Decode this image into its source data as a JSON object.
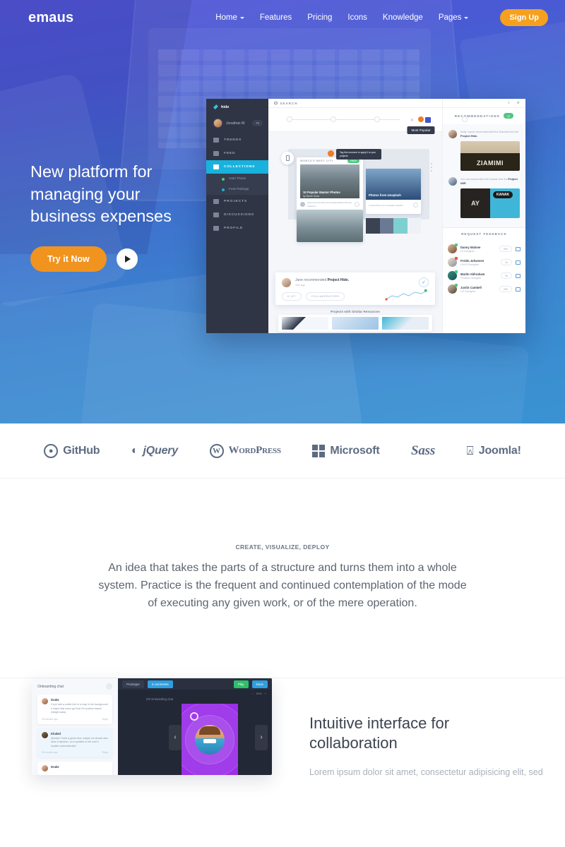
{
  "brand": {
    "logo": "emaus"
  },
  "nav": {
    "items": [
      {
        "label": "Home",
        "caret": true
      },
      {
        "label": "Features",
        "caret": false
      },
      {
        "label": "Pricing",
        "caret": false
      },
      {
        "label": "Icons",
        "caret": false
      },
      {
        "label": "Knowledge",
        "caret": false
      },
      {
        "label": "Pages",
        "caret": true
      }
    ],
    "signup_label": "Sign Up"
  },
  "hero": {
    "title_line1": "New platform for",
    "title_line2": "managing your",
    "title_line3": "business expenses",
    "cta_label": "Try it Now",
    "play_icon": "play-icon",
    "gradient_top": "#5356d6",
    "gradient_bottom": "#3a93d2",
    "accent_orange": "#f0941f"
  },
  "app": {
    "sidebar": {
      "hide_label": "hide",
      "user_name": "Jonathan M.",
      "user_badge": "75",
      "items": [
        {
          "label": "TRENDS",
          "icon": "chart-icon",
          "active": false
        },
        {
          "label": "FEED",
          "icon": "feed-icon",
          "active": false
        },
        {
          "label": "COLLECTIONS",
          "icon": "grid-icon",
          "active": true
        }
      ],
      "sub_items": [
        {
          "label": "User Flows",
          "dot": "#4ec77f"
        },
        {
          "label": "Font Pairings",
          "dot": "#18b2dd"
        }
      ],
      "items_bottom": [
        {
          "label": "PROJECTS",
          "icon": "briefcase-icon"
        },
        {
          "label": "DISCUSSIONS",
          "icon": "chat-icon"
        },
        {
          "label": "PROFILE",
          "icon": "user-icon"
        }
      ]
    },
    "main": {
      "search_label": "SEARCH",
      "tooltip": "Most Popular",
      "close_icon": "close-icon",
      "card_a": {
        "brand": "WORLD'S BEST CITY",
        "badge": "FREE",
        "caption": "10 Popular Master Photos",
        "subcaption": "by Steven Snow",
        "footer": "Jane recommended the Popular Master Photos collection",
        "footer_time": "2 hrs ago"
      },
      "card_b": {
        "caption": "Photos from Unsplash",
        "footer": "in New Photos from Unsplash collection"
      },
      "tip_a": "Tag this resource to apply it to your projects",
      "tip_b": "Tag this resource",
      "recommend": {
        "text_prefix": "Jane recommended ",
        "text_bold": "Project Hide.",
        "time": "40m ago",
        "pill1": "6,127",
        "pill2": "COLLABORATORS",
        "check_icon": "check-icon"
      },
      "similar_label": "Projects with Similar Resources"
    },
    "right": {
      "header_label": "RECOMMENDATIONS",
      "header_count": "12",
      "recs": [
        {
          "prefix": "Kelly Jones recommended the Ziamimi font for ",
          "bold": "Project Hide.",
          "poster": "ZIAMIMI"
        },
        {
          "prefix": "You recommended the Kanak font for ",
          "bold": "Project WIP.",
          "poster_l": "AY",
          "poster_r": "KANAK"
        }
      ],
      "feedback_label": "REQUEST FEEDBACK",
      "people": [
        {
          "name": "Danny Malone",
          "role": "UI Designer",
          "count": "500"
        },
        {
          "name": "Freida Johansen",
          "role": "UI/UX Designer",
          "count": "1k"
        },
        {
          "name": "Martin Abhraham",
          "role": "Product Designer",
          "count": "2k"
        },
        {
          "name": "Justin Cambell",
          "role": "UX Designer",
          "count": "250"
        }
      ]
    }
  },
  "logos": [
    {
      "name": "GitHub",
      "icon": "github-icon",
      "style": "plain"
    },
    {
      "name": "jQuery",
      "icon": "jquery-icon",
      "style": "ital"
    },
    {
      "name": "WordPress",
      "icon": "wordpress-icon",
      "style": "serif"
    },
    {
      "name": "Microsoft",
      "icon": "microsoft-icon",
      "style": "plain"
    },
    {
      "name": "Sass",
      "icon": "sass-icon",
      "style": "script"
    },
    {
      "name": "Joomla!",
      "icon": "joomla-icon",
      "style": "plain"
    }
  ],
  "intro": {
    "eyebrow": "CREATE, VISUALIZE, DEPLOY",
    "paragraph": "An idea that takes the parts of a structure and turns them into a whole system. Practice is the frequent and continued contemplation of the mode of executing any given work, or of the mere operation."
  },
  "collab": {
    "heading_line1": "Intuitive interface for",
    "heading_line2": "collaboration",
    "paragraph": "Lorem ipsum dolor sit amet, consectetur adipisicing elit, sed",
    "shot": {
      "panel_title": "Onboarding chat",
      "close_icon": "close-icon",
      "messages": [
        {
          "name": "Drake",
          "body": "If you add a subtle hint of a map in the background it might help users get that it's location based straight away.",
          "time": "26 minutes ago",
          "reply": "Reply",
          "highlight": false
        },
        {
          "name": "Khaled",
          "body": "@drake That's a great idea, maybe we should also have it dynamic, so it updates to the user's location automatically?",
          "mention": "@drake",
          "time": "26 minutes ago",
          "reply": "Reply",
          "highlight": true
        },
        {
          "name": "Drake",
          "body": "",
          "time": "",
          "reply": "",
          "highlight": false
        }
      ],
      "toolbar": {
        "prototype": "Prototype",
        "comments": "3 comments",
        "play": "Play",
        "done": "Done",
        "zoom": "50%"
      },
      "canvas_title": "2/6  Onboarding chat"
    }
  }
}
